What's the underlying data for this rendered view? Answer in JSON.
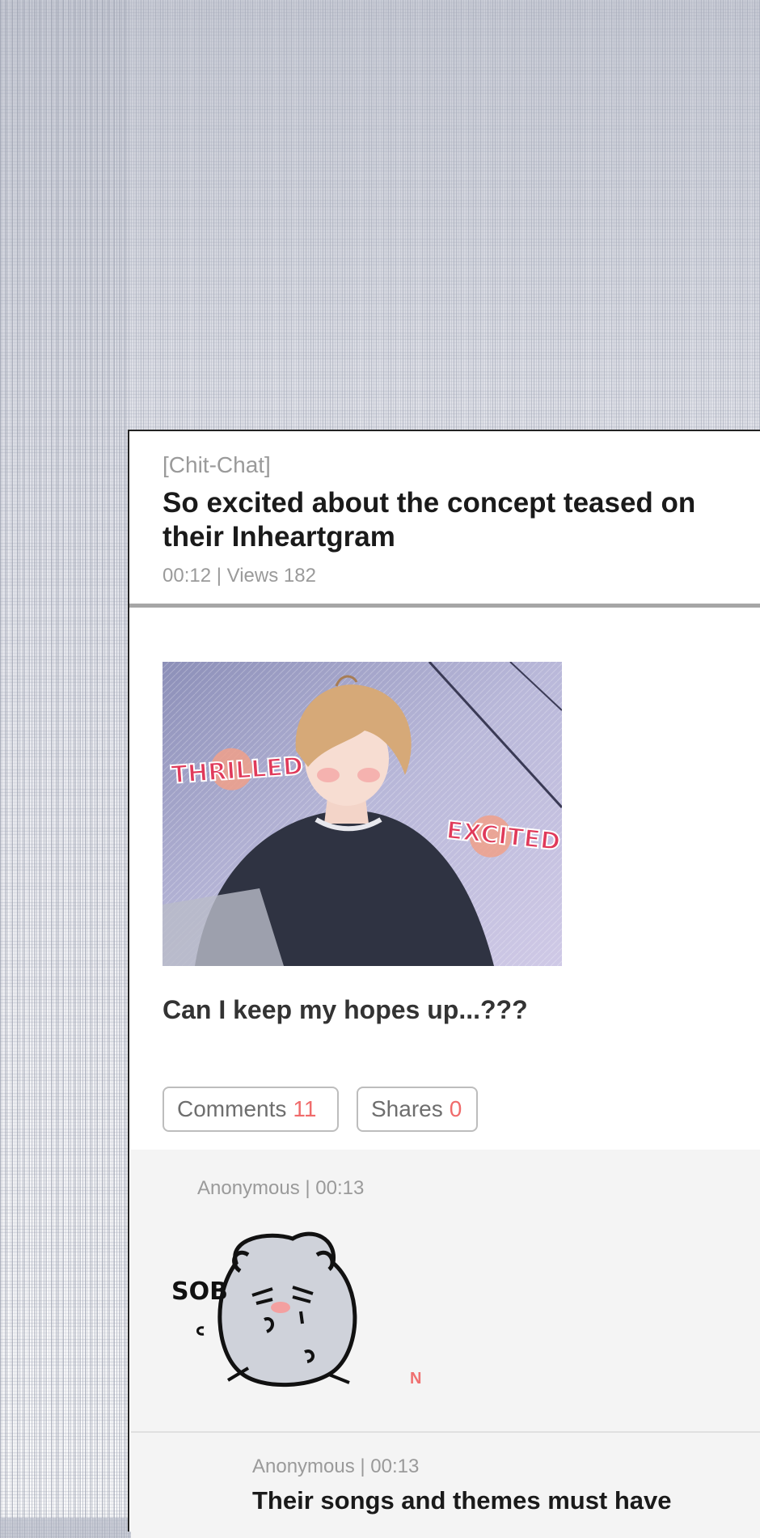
{
  "post": {
    "category": "[Chit-Chat]",
    "title": "So excited about the concept teased on their Inheartgram",
    "meta": "00:12 | Views 182",
    "body": "Can I keep my hopes up...???",
    "image": {
      "label_left": "THRILLED",
      "label_right": "EXCITED"
    }
  },
  "actions": {
    "comments_label": "Comments",
    "comments_count": "11",
    "shares_label": "Shares",
    "shares_count": "0"
  },
  "comments": [
    {
      "meta": "Anonymous | 00:13",
      "sticker": {
        "sound": "SOB",
        "icon": "crying-hamster-sticker"
      },
      "marker": "N"
    },
    {
      "meta": "Anonymous | 00:13",
      "text": "Their songs and themes must have"
    }
  ],
  "colors": {
    "accent": "#f06b6b",
    "text_primary": "#1a1a1a",
    "text_muted": "#9a9a9a",
    "comment_bg": "#f4f4f4"
  }
}
